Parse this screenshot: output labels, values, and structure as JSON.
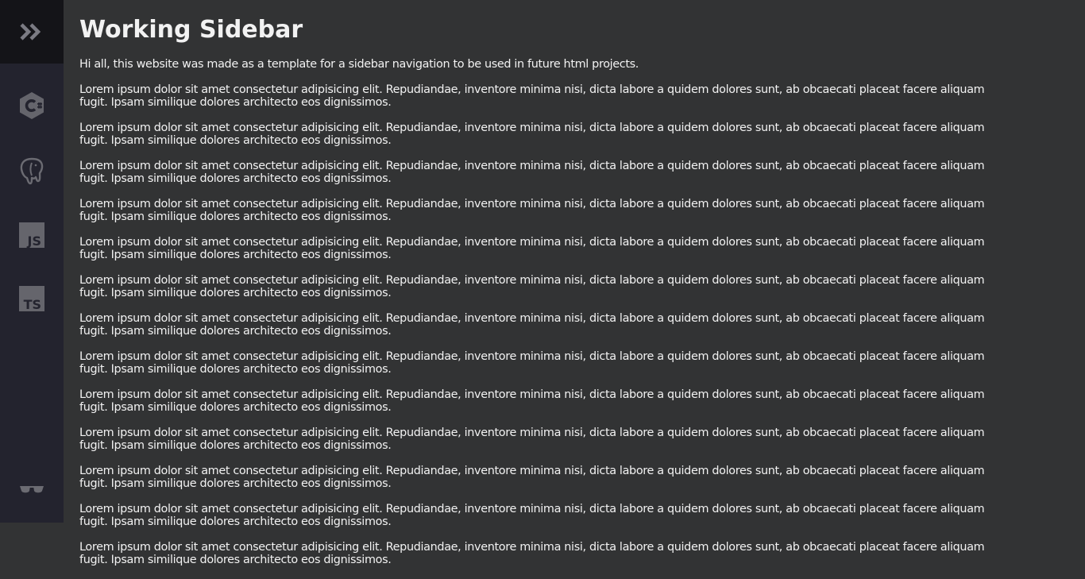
{
  "sidebar": {
    "items": [
      {
        "name": "csharp",
        "icon": "csharp-icon"
      },
      {
        "name": "postgresql",
        "icon": "postgresql-elephant-icon"
      },
      {
        "name": "javascript",
        "icon": "javascript-icon",
        "label": "JS"
      },
      {
        "name": "typescript",
        "icon": "typescript-icon",
        "label": "TS"
      },
      {
        "name": "theme",
        "icon": "sunglasses-icon"
      }
    ],
    "toggle_icon": "double-chevron-right-icon",
    "colors": {
      "background": "#23232e",
      "logo_background": "#141418",
      "icon": "#6b6b72"
    }
  },
  "main": {
    "title": "Working Sidebar",
    "intro": "Hi all, this website was made as a template for a sidebar navigation to be used in future html projects.",
    "paragraphs": [
      {
        "line1": "Lorem ipsum dolor sit amet consectetur adipisicing elit. Repudiandae, inventore minima nisi, dicta labore a quidem dolores sunt, ab obcaecati placeat facere aliquam",
        "line2": "fugit. Ipsam similique dolores architecto eos dignissimos."
      },
      {
        "line1": "Lorem ipsum dolor sit amet consectetur adipisicing elit. Repudiandae, inventore minima nisi, dicta labore a quidem dolores sunt, ab obcaecati placeat facere aliquam",
        "line2": "fugit. Ipsam similique dolores architecto eos dignissimos."
      },
      {
        "line1": "Lorem ipsum dolor sit amet consectetur adipisicing elit. Repudiandae, inventore minima nisi, dicta labore a quidem dolores sunt, ab obcaecati placeat facere aliquam",
        "line2": "fugit. Ipsam similique dolores architecto eos dignissimos."
      },
      {
        "line1": "Lorem ipsum dolor sit amet consectetur adipisicing elit. Repudiandae, inventore minima nisi, dicta labore a quidem dolores sunt, ab obcaecati placeat facere aliquam",
        "line2": "fugit. Ipsam similique dolores architecto eos dignissimos."
      },
      {
        "line1": "Lorem ipsum dolor sit amet consectetur adipisicing elit. Repudiandae, inventore minima nisi, dicta labore a quidem dolores sunt, ab obcaecati placeat facere aliquam",
        "line2": "fugit. Ipsam similique dolores architecto eos dignissimos."
      },
      {
        "line1": "Lorem ipsum dolor sit amet consectetur adipisicing elit. Repudiandae, inventore minima nisi, dicta labore a quidem dolores sunt, ab obcaecati placeat facere aliquam",
        "line2": "fugit. Ipsam similique dolores architecto eos dignissimos."
      },
      {
        "line1": "Lorem ipsum dolor sit amet consectetur adipisicing elit. Repudiandae, inventore minima nisi, dicta labore a quidem dolores sunt, ab obcaecati placeat facere aliquam",
        "line2": "fugit. Ipsam similique dolores architecto eos dignissimos."
      },
      {
        "line1": "Lorem ipsum dolor sit amet consectetur adipisicing elit. Repudiandae, inventore minima nisi, dicta labore a quidem dolores sunt, ab obcaecati placeat facere aliquam",
        "line2": "fugit. Ipsam similique dolores architecto eos dignissimos."
      },
      {
        "line1": "Lorem ipsum dolor sit amet consectetur adipisicing elit. Repudiandae, inventore minima nisi, dicta labore a quidem dolores sunt, ab obcaecati placeat facere aliquam",
        "line2": "fugit. Ipsam similique dolores architecto eos dignissimos."
      },
      {
        "line1": "Lorem ipsum dolor sit amet consectetur adipisicing elit. Repudiandae, inventore minima nisi, dicta labore a quidem dolores sunt, ab obcaecati placeat facere aliquam",
        "line2": "fugit. Ipsam similique dolores architecto eos dignissimos."
      },
      {
        "line1": "Lorem ipsum dolor sit amet consectetur adipisicing elit. Repudiandae, inventore minima nisi, dicta labore a quidem dolores sunt, ab obcaecati placeat facere aliquam",
        "line2": "fugit. Ipsam similique dolores architecto eos dignissimos."
      },
      {
        "line1": "Lorem ipsum dolor sit amet consectetur adipisicing elit. Repudiandae, inventore minima nisi, dicta labore a quidem dolores sunt, ab obcaecati placeat facere aliquam",
        "line2": "fugit. Ipsam similique dolores architecto eos dignissimos."
      },
      {
        "line1": "Lorem ipsum dolor sit amet consectetur adipisicing elit. Repudiandae, inventore minima nisi, dicta labore a quidem dolores sunt, ab obcaecati placeat facere aliquam",
        "line2": "fugit. Ipsam similique dolores architecto eos dignissimos."
      }
    ],
    "colors": {
      "background": "#323334",
      "text": "#f2f2f2"
    }
  }
}
